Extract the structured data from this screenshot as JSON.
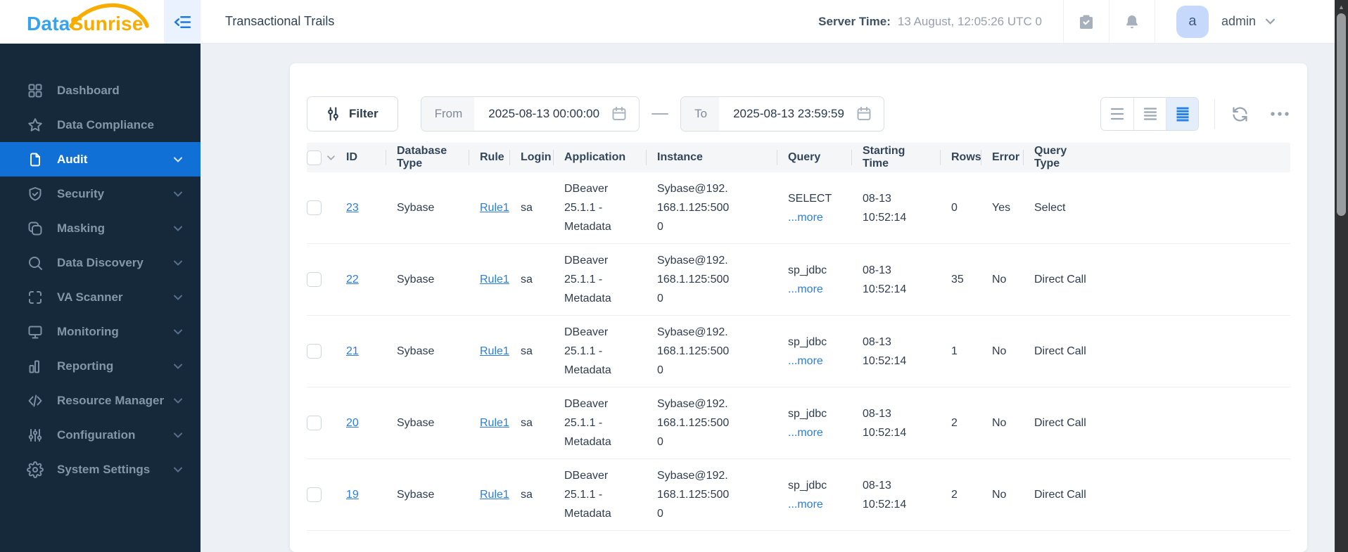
{
  "colors": {
    "sidebar_bg": "#16293b",
    "active_item_bg": "#1170d6",
    "link_blue": "#2a7de1",
    "logo_blue": "#35a3ee",
    "logo_orange": "#f8ac00",
    "table_header_bg": "#f4f6f8",
    "page_bg": "#edf1f5"
  },
  "brand": {
    "name_part1": "Data",
    "name_part2": "Sunrise"
  },
  "topbar": {
    "title": "Transactional Trails",
    "server_time_label": "Server Time:",
    "server_time_value": "13 August, 12:05:26 UTC 0",
    "user_initial": "a",
    "user_name": "admin"
  },
  "sidebar": {
    "items": [
      {
        "label": "Dashboard",
        "icon": "dashboard-icon",
        "expandable": false,
        "active": false
      },
      {
        "label": "Data Compliance",
        "icon": "star-icon",
        "expandable": false,
        "active": false
      },
      {
        "label": "Audit",
        "icon": "document-icon",
        "expandable": true,
        "active": true
      },
      {
        "label": "Security",
        "icon": "shield-icon",
        "expandable": true,
        "active": false
      },
      {
        "label": "Masking",
        "icon": "masking-icon",
        "expandable": true,
        "active": false
      },
      {
        "label": "Data Discovery",
        "icon": "search-icon",
        "expandable": true,
        "active": false
      },
      {
        "label": "VA Scanner",
        "icon": "scanner-icon",
        "expandable": true,
        "active": false
      },
      {
        "label": "Monitoring",
        "icon": "monitor-icon",
        "expandable": true,
        "active": false
      },
      {
        "label": "Reporting",
        "icon": "bar-chart-icon",
        "expandable": true,
        "active": false
      },
      {
        "label": "Resource Manager",
        "icon": "code-icon",
        "expandable": true,
        "active": false
      },
      {
        "label": "Configuration",
        "icon": "sliders-icon",
        "expandable": true,
        "active": false
      },
      {
        "label": "System Settings",
        "icon": "gear-icon",
        "expandable": true,
        "active": false
      }
    ]
  },
  "toolbar": {
    "filter_label": "Filter",
    "from_label": "From",
    "from_value": "2025-08-13 00:00:00",
    "to_label": "To",
    "to_value": "2025-08-13 23:59:59",
    "view_options": [
      {
        "icon": "rows-sparse-icon",
        "active": false
      },
      {
        "icon": "rows-medium-icon",
        "active": false
      },
      {
        "icon": "rows-dense-icon",
        "active": true
      }
    ]
  },
  "table": {
    "more_label": "...more",
    "columns": [
      {
        "key": "select",
        "label": ""
      },
      {
        "key": "id",
        "label": "ID"
      },
      {
        "key": "database_type",
        "label": "Database Type"
      },
      {
        "key": "rule",
        "label": "Rule"
      },
      {
        "key": "login",
        "label": "Login"
      },
      {
        "key": "application",
        "label": "Application"
      },
      {
        "key": "instance",
        "label": "Instance"
      },
      {
        "key": "query",
        "label": "Query"
      },
      {
        "key": "starting_time",
        "label": "Starting Time"
      },
      {
        "key": "rows",
        "label": "Rows"
      },
      {
        "key": "error",
        "label": "Error"
      },
      {
        "key": "query_type",
        "label": "Query Type"
      }
    ],
    "rows": [
      {
        "id": "23",
        "database_type": "Sybase",
        "rule": "Rule1",
        "login": "sa",
        "application": "DBeaver 25.1.1 - Metadata",
        "instance": "Sybase@192.168.1.125:5000",
        "query": "SELECT",
        "starting_time": "08-13 10:52:14",
        "rows": "0",
        "error": "Yes",
        "query_type": "Select"
      },
      {
        "id": "22",
        "database_type": "Sybase",
        "rule": "Rule1",
        "login": "sa",
        "application": "DBeaver 25.1.1 - Metadata",
        "instance": "Sybase@192.168.1.125:5000",
        "query": "sp_jdbc",
        "starting_time": "08-13 10:52:14",
        "rows": "35",
        "error": "No",
        "query_type": "Direct Call"
      },
      {
        "id": "21",
        "database_type": "Sybase",
        "rule": "Rule1",
        "login": "sa",
        "application": "DBeaver 25.1.1 - Metadata",
        "instance": "Sybase@192.168.1.125:5000",
        "query": "sp_jdbc",
        "starting_time": "08-13 10:52:14",
        "rows": "1",
        "error": "No",
        "query_type": "Direct Call"
      },
      {
        "id": "20",
        "database_type": "Sybase",
        "rule": "Rule1",
        "login": "sa",
        "application": "DBeaver 25.1.1 - Metadata",
        "instance": "Sybase@192.168.1.125:5000",
        "query": "sp_jdbc",
        "starting_time": "08-13 10:52:14",
        "rows": "2",
        "error": "No",
        "query_type": "Direct Call"
      },
      {
        "id": "19",
        "database_type": "Sybase",
        "rule": "Rule1",
        "login": "sa",
        "application": "DBeaver 25.1.1 - Metadata",
        "instance": "Sybase@192.168.1.125:5000",
        "query": "sp_jdbc",
        "starting_time": "08-13 10:52:14",
        "rows": "2",
        "error": "No",
        "query_type": "Direct Call"
      }
    ]
  }
}
